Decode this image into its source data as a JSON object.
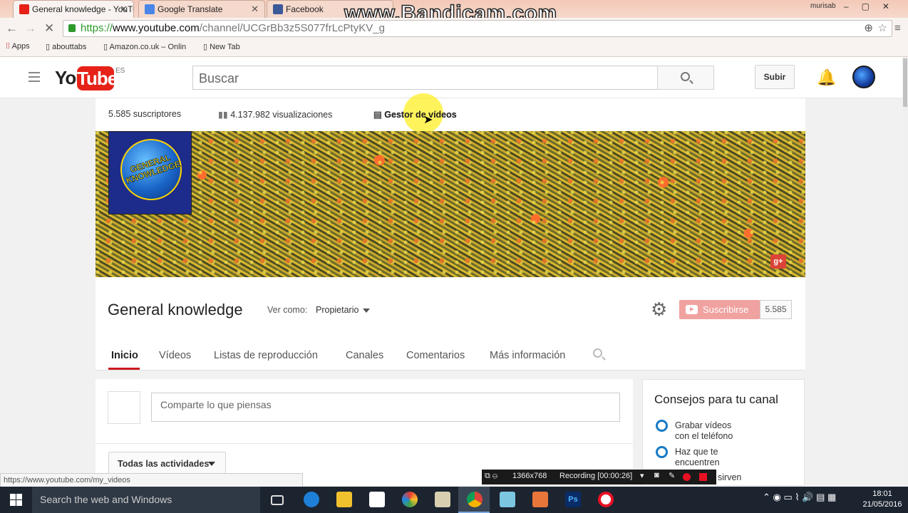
{
  "browser": {
    "tabs": [
      {
        "label": "General knowledge - YouTube"
      },
      {
        "label": "Google Translate"
      },
      {
        "label": "Facebook"
      }
    ],
    "url_prefix": "https://",
    "url_host": "www.youtube.com",
    "url_path": "/channel/UCGrBb3z5S077frLcPtyKV_g",
    "bookmarks": [
      "Apps",
      "abouttabs",
      "Amazon.co.uk – Onlin",
      "New Tab"
    ],
    "watermark": "www.Bandicam.com",
    "profile": "murisab"
  },
  "youtube": {
    "logo_you": "You",
    "logo_tube": "Tube",
    "logo_region": "ES",
    "search_placeholder": "Buscar",
    "upload_label": "Subir"
  },
  "channel": {
    "subscribers": "5.585 suscriptores",
    "views": "4.137.982 visualizaciones",
    "manager": "Gestor de vídeos",
    "logo_text": "GENERAL KNOWLEDGE",
    "gplus": "g+",
    "name": "General knowledge",
    "view_as_label": "Ver como:",
    "view_as_value": "Propietario",
    "subscribe_label": "Suscribirse",
    "subscribe_count": "5.585",
    "tabs": [
      "Inicio",
      "Vídeos",
      "Listas de reproducción",
      "Canales",
      "Comentarios",
      "Más información"
    ],
    "share_placeholder": "Comparte lo que piensas",
    "activity_filter": "Todas las actividades"
  },
  "tips": {
    "title": "Consejos para tu canal",
    "items": [
      "Grabar vídeos\ncon el teléfono",
      "Haz que te\nencuentren"
    ],
    "partial": "sirven"
  },
  "status_url": "https://www.youtube.com/my_videos",
  "recorder": {
    "resolution": "1366x768",
    "status": "Recording [00:00:26]"
  },
  "taskbar": {
    "search": "Search the web and Windows",
    "time": "18:01",
    "date": "21/05/2016"
  },
  "colors": {
    "youtube_red": "#e62117",
    "subscribe_bg": "#f0a2a0",
    "tab_accent": "#cc181e",
    "tip_radio": "#167ac6"
  }
}
